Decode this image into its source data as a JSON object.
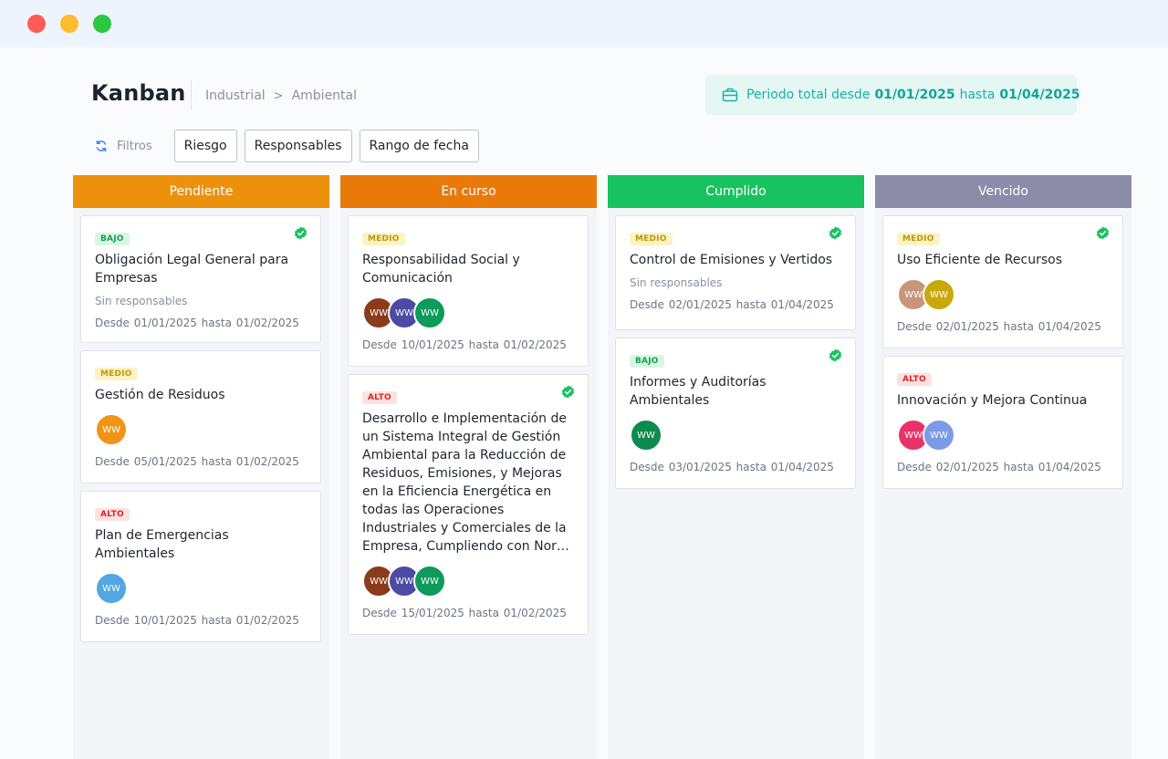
{
  "window": {
    "controls": [
      "close",
      "minimize",
      "maximize"
    ]
  },
  "header": {
    "title": "Kanban",
    "breadcrumb": [
      "Industrial",
      "Ambiental"
    ],
    "breadcrumb_separator": ">",
    "period": {
      "prefix": "Periodo total desde",
      "start": "01/01/2025",
      "middle": "hasta",
      "end": "01/04/2025",
      "icon": "briefcase-icon"
    }
  },
  "filters": {
    "label": "Filtros",
    "icon": "refresh-icon",
    "buttons": [
      "Riesgo",
      "Responsables",
      "Rango de fecha"
    ]
  },
  "colors": {
    "pendiente": "#ed910d",
    "en_curso": "#e97a0a",
    "cumplido": "#18c260",
    "vencido": "#8a8ca8",
    "teal": "#17b2a0"
  },
  "columns": [
    {
      "title": "Pendiente",
      "cards": [
        {
          "badge": "BAJO",
          "checked": true,
          "title": "Obligación Legal General para Empresas",
          "no_responsables": "Sin responsables",
          "dates": "Desde 01/01/2025  hasta  01/02/2025"
        },
        {
          "badge": "MEDIO",
          "checked": false,
          "title": "Gestión de Residuos",
          "avatars": [
            {
              "initials": "WW",
              "color": "#f39315"
            }
          ],
          "dates": "Desde 05/01/2025  hasta  01/02/2025"
        },
        {
          "badge": "ALTO",
          "checked": false,
          "title": "Plan de Emergencias Ambientales",
          "avatars": [
            {
              "initials": "WW",
              "color": "#52a6e1"
            }
          ],
          "dates": "Desde 10/01/2025  hasta  01/02/2025"
        }
      ]
    },
    {
      "title": "En curso",
      "cards": [
        {
          "badge": "MEDIO",
          "checked": false,
          "title": "Responsabilidad Social y Comunicación",
          "avatars": [
            {
              "initials": "WW",
              "color": "#8b3a1c"
            },
            {
              "initials": "WW",
              "color": "#4b4ba3"
            },
            {
              "initials": "WW",
              "color": "#0e9a5a"
            }
          ],
          "dates": "Desde 10/01/2025  hasta  01/02/2025"
        },
        {
          "badge": "ALTO",
          "checked": true,
          "title": "Desarrollo e Implementación de un Sistema Integral de Gestión Ambiental para la Reducción de Residuos, Emisiones, y Mejoras en la Eficiencia Energética en todas las Operaciones Industriales y Comerciales de la Empresa, Cumpliendo con Nor…",
          "avatars": [
            {
              "initials": "WW",
              "color": "#8b3a1c"
            },
            {
              "initials": "WW",
              "color": "#4b4ba3"
            },
            {
              "initials": "WW",
              "color": "#0e9a5a"
            }
          ],
          "dates": "Desde 15/01/2025  hasta  01/02/2025"
        }
      ]
    },
    {
      "title": "Cumplido",
      "cards": [
        {
          "badge": "MEDIO",
          "checked": true,
          "title": "Control de Emisiones y Vertidos",
          "no_responsables": "Sin responsables",
          "dates": "Desde 02/01/2025  hasta  01/04/2025"
        },
        {
          "badge": "BAJO",
          "checked": true,
          "title": "Informes y Auditorías Ambientales",
          "avatars": [
            {
              "initials": "WW",
              "color": "#0e8a4e"
            }
          ],
          "dates": "Desde 03/01/2025  hasta  01/04/2025"
        }
      ]
    },
    {
      "title": "Vencido",
      "cards": [
        {
          "badge": "MEDIO",
          "checked": true,
          "title": "Uso Eficiente de Recursos",
          "avatars": [
            {
              "initials": "WW",
              "color": "#c9957a"
            },
            {
              "initials": "WW",
              "color": "#c9a80a"
            }
          ],
          "dates": "Desde 02/01/2025  hasta  01/04/2025"
        },
        {
          "badge": "ALTO",
          "checked": false,
          "title": "Innovación y Mejora Continua",
          "avatars": [
            {
              "initials": "WW",
              "color": "#e8336a"
            },
            {
              "initials": "WW",
              "color": "#7b9be6"
            }
          ],
          "dates": "Desde 02/01/2025  hasta  01/04/2025"
        }
      ]
    }
  ]
}
